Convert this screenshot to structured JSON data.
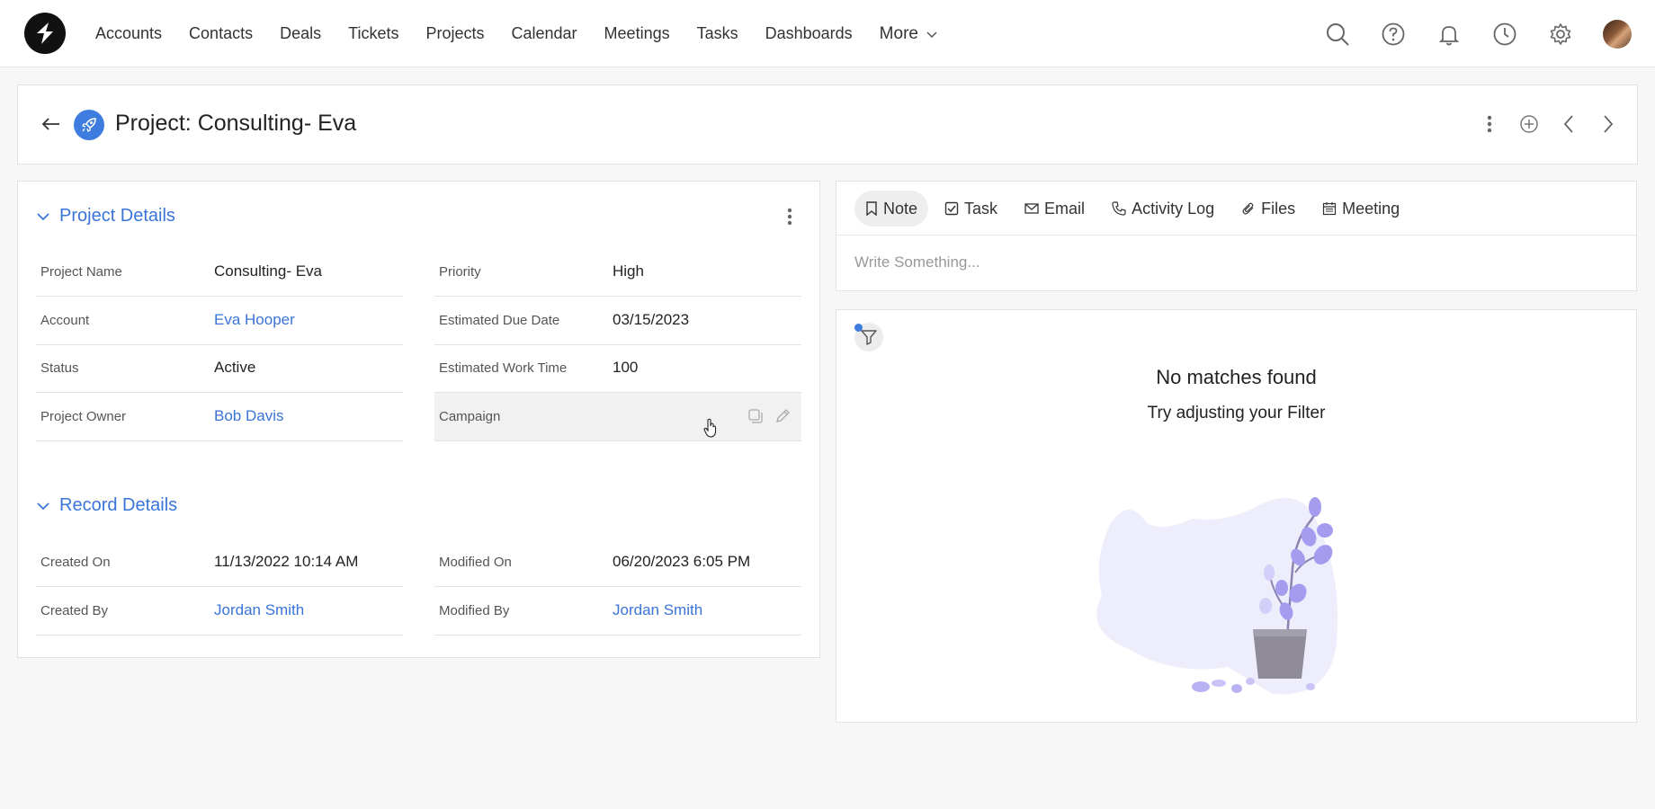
{
  "nav": {
    "links": [
      "Accounts",
      "Contacts",
      "Deals",
      "Tickets",
      "Projects",
      "Calendar",
      "Meetings",
      "Tasks",
      "Dashboards"
    ],
    "more_label": "More",
    "icons": [
      "search-icon",
      "help-icon",
      "bell-icon",
      "clock-icon",
      "gear-icon"
    ]
  },
  "header": {
    "title": "Project: Consulting- Eva",
    "actions": [
      "more-vertical-icon",
      "add-circle-icon",
      "chevron-left-icon",
      "chevron-right-icon"
    ]
  },
  "project_details": {
    "title": "Project Details",
    "left": [
      {
        "label": "Project Name",
        "value": "Consulting- Eva",
        "link": false
      },
      {
        "label": "Account",
        "value": "Eva Hooper",
        "link": true
      },
      {
        "label": "Status",
        "value": "Active",
        "link": false
      },
      {
        "label": "Project Owner",
        "value": "Bob Davis",
        "link": true
      }
    ],
    "right": [
      {
        "label": "Priority",
        "value": "High",
        "link": false
      },
      {
        "label": "Estimated Due Date",
        "value": "03/15/2023",
        "link": false
      },
      {
        "label": "Estimated Work Time",
        "value": "100",
        "link": false
      },
      {
        "label": "Campaign",
        "value": "",
        "link": false
      }
    ]
  },
  "record_details": {
    "title": "Record Details",
    "left": [
      {
        "label": "Created On",
        "value": "11/13/2022 10:14 AM",
        "link": false
      },
      {
        "label": "Created By",
        "value": "Jordan Smith",
        "link": true
      }
    ],
    "right": [
      {
        "label": "Modified On",
        "value": "06/20/2023 6:05 PM",
        "link": false
      },
      {
        "label": "Modified By",
        "value": "Jordan Smith",
        "link": true
      }
    ]
  },
  "composer": {
    "tabs": [
      "Note",
      "Task",
      "Email",
      "Activity Log",
      "Files",
      "Meeting"
    ],
    "active_tab": "Note",
    "placeholder": "Write Something..."
  },
  "feed": {
    "empty_title": "No matches found",
    "empty_subtitle": "Try adjusting your Filter"
  },
  "colors": {
    "accent": "#3a74d8",
    "illustration": "#a59cf0"
  }
}
